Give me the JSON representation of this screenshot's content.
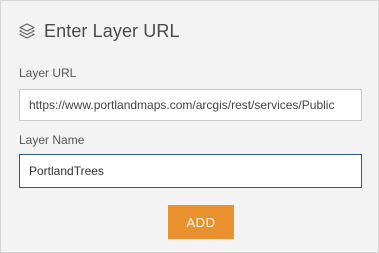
{
  "header": {
    "icon": "layers-icon",
    "title": "Enter Layer URL"
  },
  "form": {
    "url_label": "Layer URL",
    "url_value": "https://www.portlandmaps.com/arcgis/rest/services/Public",
    "name_label": "Layer Name",
    "name_value": "PortlandTrees"
  },
  "actions": {
    "add_label": "ADD",
    "add_color": "#e8912e"
  }
}
